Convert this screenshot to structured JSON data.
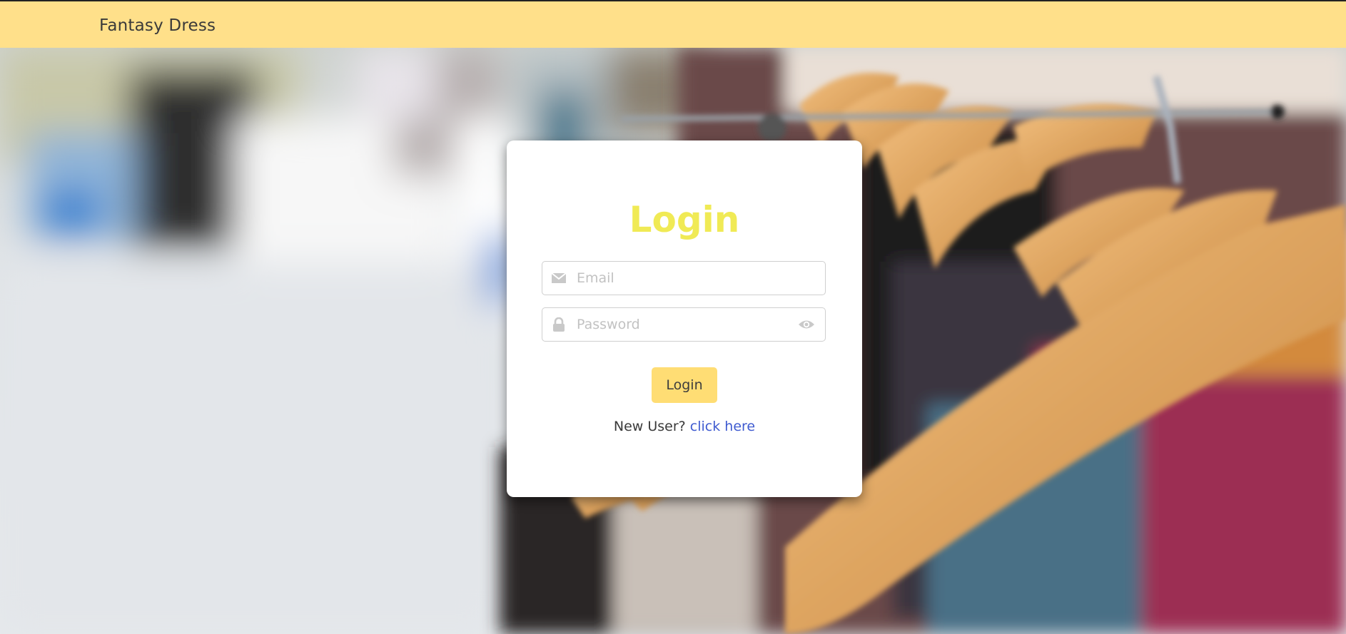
{
  "navbar": {
    "brand": "Fantasy Dress",
    "bg_color": "#ffe08a"
  },
  "login_form": {
    "title": "Login",
    "title_color": "#f0ea55",
    "email_placeholder": "Email",
    "password_placeholder": "Password",
    "submit_label": "Login",
    "submit_color": "#ffdd74",
    "signup_prompt": "New User?",
    "signup_link": "click here",
    "link_color": "#3f5bd0",
    "icons": {
      "email": "envelope-icon",
      "password": "lock-icon",
      "toggle_visibility": "eye-icon"
    }
  },
  "background": {
    "description_icon": "clothing-rack-photo"
  }
}
